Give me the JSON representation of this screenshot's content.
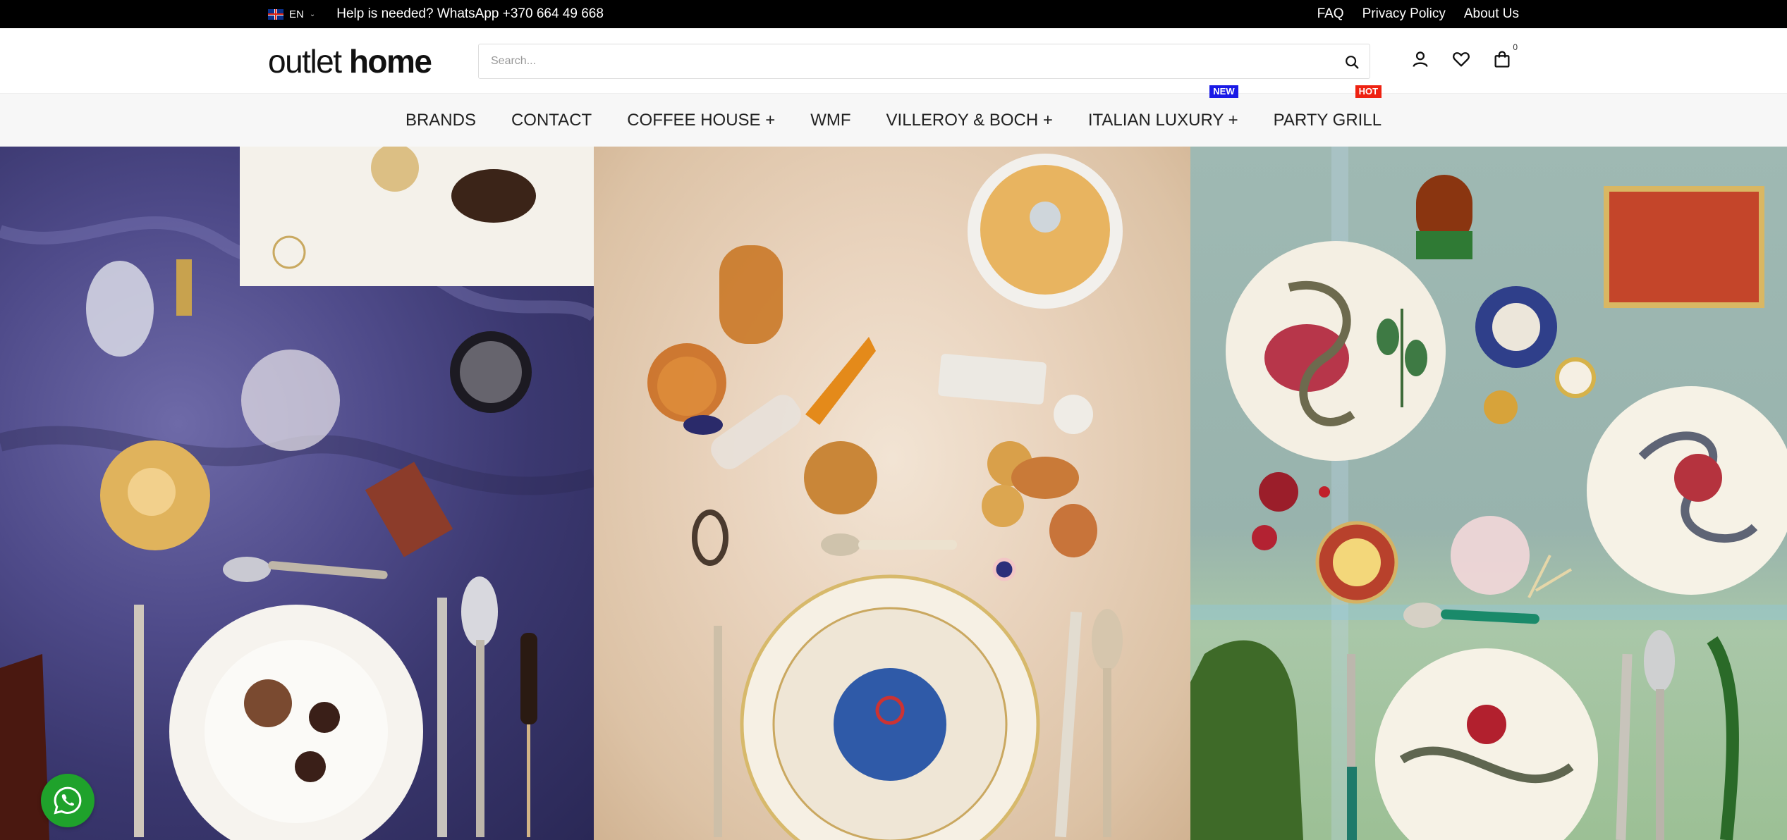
{
  "topbar": {
    "language": "EN",
    "help_text": "Help is needed? WhatsApp +370 664 49 668",
    "links": [
      "FAQ",
      "Privacy Policy",
      "About Us"
    ]
  },
  "header": {
    "logo_part1": "outlet",
    "logo_part2": "home",
    "search_placeholder": "Search...",
    "cart_count": "0",
    "icons": [
      "search-icon",
      "account-icon",
      "wishlist-heart-icon",
      "cart-bag-icon"
    ]
  },
  "nav": {
    "items": [
      {
        "label": "BRANDS"
      },
      {
        "label": "CONTACT"
      },
      {
        "label": "COFFEE HOUSE +"
      },
      {
        "label": "WMF"
      },
      {
        "label": "VILLEROY & BOCH +"
      },
      {
        "label": "ITALIAN LUXURY +",
        "tag": "NEW"
      },
      {
        "label": "PARTY GRILL",
        "tag": "HOT"
      }
    ]
  },
  "colors": {
    "topbar_bg": "#000000",
    "nav_bg": "#f7f7f7",
    "tag_new": "#1a1ae6",
    "tag_hot": "#ee2211",
    "whatsapp": "#1fa22b"
  },
  "hero": {
    "panels": [
      "purple-marble-tableware-photo",
      "beige-zodiac-tableware-photo",
      "green-snake-tableware-photo"
    ]
  },
  "floating": {
    "whatsapp_icon": "whatsapp-icon"
  }
}
